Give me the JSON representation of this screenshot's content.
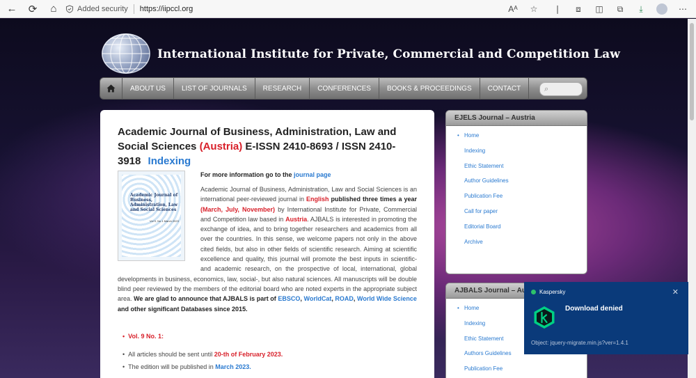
{
  "browser": {
    "security_label": "Added security",
    "url": "https://iipccl.org",
    "reader_label": "Aᴬ"
  },
  "site": {
    "title": "International Institute for Private, Commercial and Competition Law"
  },
  "menu": {
    "items": [
      "About Us",
      "List of Journals",
      "Research",
      "Conferences",
      "Books & Proceedings",
      "Contact"
    ],
    "search_placeholder": "⌕"
  },
  "article": {
    "title_prefix": "Academic Journal of Business, Administration, Law and Social Sciences",
    "title_country": "(Austria)",
    "title_issn": "E-ISSN 2410-8693 / ISSN 2410-3918",
    "title_link": "Indexing",
    "cover_title": "Academic Journal of Business, Administration, Law and Social Sciences",
    "cover_vol": "Vol 9, No 1 March 2023",
    "more_prefix": "For more information go to the",
    "more_link": "journal page",
    "p1": "Academic Journal of Business, Administration, Law and Social Sciences is an international peer-reviewed journal in",
    "p_english": "English",
    "p_published": "published three times a year",
    "p_months": "(March, July, November)",
    "p2": "by International Institute for Private, Commercial and Competition law based in",
    "p_austria": "Austria",
    "p3": ". AJBALS is interested in promoting the exchange of idea, and to bring together researchers and academics from all over the countries. In this sense, we welcome papers not only in the above cited fields, but also in other fields of scientific research. Aiming at scientific excellence and quality, this journal will promote the best inputs in scientific- and academic research, on the prospective of local, international, global developments in business, economics, law, social-, but also natural sciences. All manuscripts will be double blind peer reviewed by the members of the editorial board who are noted experts in the appropriate subject area.",
    "p_glad": "We are glad to announce that AJBALS is part of",
    "p_ebsco": "EBSCO",
    "p_worldcat": "WorldCat",
    "p_road": "ROAD",
    "p_wws": "World Wide Science",
    "p_end": "and other significant Databases since 2015.",
    "comma": ",",
    "vol": "Vol. 9 No. 1:",
    "bullet1_prefix": "All articles should be sent until",
    "bullet1_date": "20-th of February 2023.",
    "bullet2_prefix": "The edition will be published in",
    "bullet2_date": "March 2023."
  },
  "sidebar1": {
    "title": "EJELS Journal – Austria",
    "links": [
      "Home",
      "Indexing",
      "Ethic Statement",
      "Author Guidelines",
      "Publication Fee",
      "Call for paper",
      "Editorial Board",
      "Archive"
    ]
  },
  "sidebar2": {
    "title": "AJBALS Journal – Au",
    "links": [
      "Home",
      "Indexing",
      "Ethic Statement",
      "Authors Guidelines",
      "Publication Fee"
    ]
  },
  "toast": {
    "brand": "Kaspersky",
    "title": "Download denied",
    "object": "Object: jquery-migrate.min.js?ver=1.4.1"
  },
  "colors": {
    "accent_red": "#d8202a",
    "link_blue": "#2a7ad0",
    "toast_bg": "#0a3a7a",
    "kaspersky_green": "#2ec36a"
  }
}
